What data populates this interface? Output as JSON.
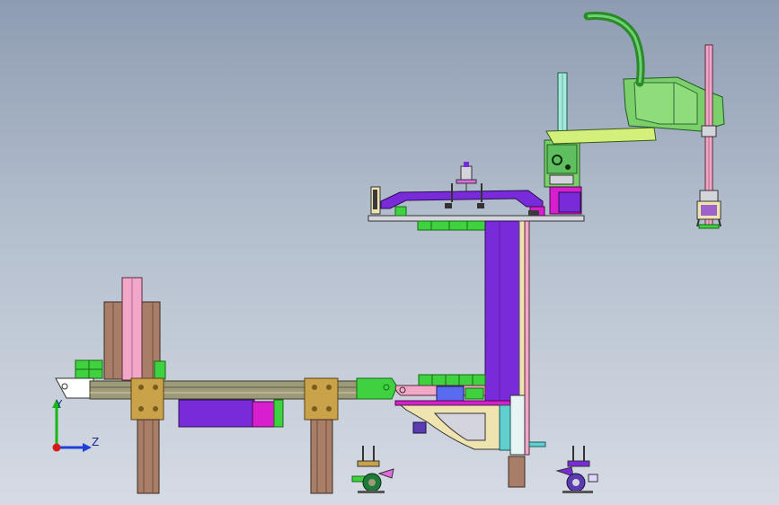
{
  "viewport": {
    "background_top": "#8e9cb2",
    "background_bottom": "#d6dbe4"
  },
  "triad": {
    "y_label": "Y",
    "z_label": "Z",
    "y_axis_color": "#16b816",
    "z_axis_color": "#1f3fd6",
    "origin_color": "#d61a1a"
  },
  "model": {
    "colors": {
      "frame_green": "#3fd13f",
      "robot_green": "#7bd06b",
      "rail_olive": "#9c9a78",
      "bracket_gold": "#c9a24a",
      "leg_brown": "#a87e68",
      "column_purple": "#7a2bd9",
      "magenta": "#d81fcf",
      "pink": "#f2a6c8",
      "lime": "#9de04a",
      "cream": "#efe3b0",
      "plate_gray": "#d4d4dc"
    }
  }
}
